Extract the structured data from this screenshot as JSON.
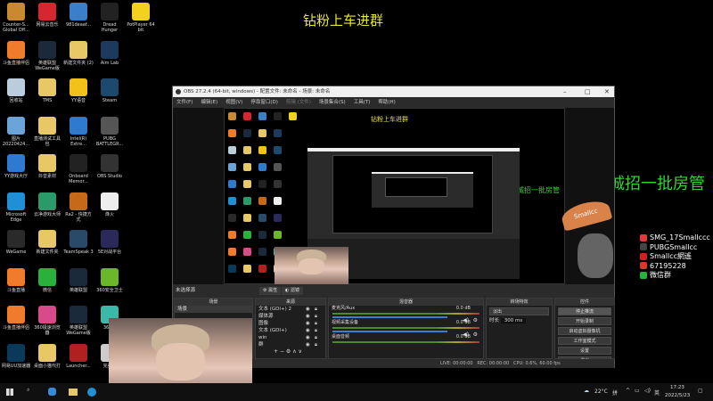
{
  "desktop_icons": [
    {
      "label": "Counter-S... Global Off...",
      "color": "#c8892f"
    },
    {
      "label": "网易云音乐",
      "color": "#d8262e"
    },
    {
      "label": "981deaaf...",
      "color": "#3a7fc9"
    },
    {
      "label": "Dread Hunger",
      "color": "#222"
    },
    {
      "label": "PotPlayer 64 bit",
      "color": "#f2d21b"
    },
    {
      "label": "斗鱼直播伴侣",
      "color": "#f07b2a"
    },
    {
      "label": "英雄联盟 WeGame版",
      "color": "#1a2a3a"
    },
    {
      "label": "新建文件夹 (2)",
      "color": "#e8c766"
    },
    {
      "label": "Aim Lab",
      "color": "#1c3b5c"
    },
    null,
    {
      "label": "回收站",
      "color": "#bcd"
    },
    {
      "label": "TMS",
      "color": "#e8c766"
    },
    {
      "label": "YY语音",
      "color": "#f2c21b"
    },
    {
      "label": "Steam",
      "color": "#1b4a6e"
    },
    null,
    {
      "label": "图片 20220424...",
      "color": "#6aa4d8"
    },
    {
      "label": "直播测试工具包",
      "color": "#e8c766"
    },
    {
      "label": "Intel(R) Extre...",
      "color": "#2e7ad0"
    },
    {
      "label": "PUBG BATTLEGR...",
      "color": "#555"
    },
    null,
    {
      "label": "YY游戏大厅",
      "color": "#2e7ad0"
    },
    {
      "label": "抖音素材",
      "color": "#e8c766"
    },
    {
      "label": "Onboard Memor...",
      "color": "#222"
    },
    {
      "label": "OBS Studio",
      "color": "#333"
    },
    null,
    {
      "label": "Microsoft Edge",
      "color": "#1f8fd6"
    },
    {
      "label": "云净游戏大师",
      "color": "#2a9a6a"
    },
    {
      "label": "Ra2 - 快捷方式",
      "color": "#c66a1a"
    },
    {
      "label": "烽火",
      "color": "#eee"
    },
    null,
    {
      "label": "WeGame",
      "color": "#2a2a2a"
    },
    {
      "label": "新建文件夹",
      "color": "#e8c766"
    },
    {
      "label": "TeamSpeak 3",
      "color": "#2a4a6a"
    },
    {
      "label": "5E对战平台",
      "color": "#2a2a5a"
    },
    null,
    {
      "label": "斗鱼直播",
      "color": "#f07b2a"
    },
    {
      "label": "微信",
      "color": "#2ab13c"
    },
    {
      "label": "英雄联盟",
      "color": "#1a2a3a"
    },
    {
      "label": "360安全卫士",
      "color": "#6ab82a"
    },
    null,
    {
      "label": "斗鱼直播伴侣",
      "color": "#f07b2a"
    },
    {
      "label": "360极速浏览器",
      "color": "#d84a8a"
    },
    {
      "label": "英雄联盟 WeGame版",
      "color": "#1a2a3a"
    },
    {
      "label": "360...",
      "color": "#3ab8a8"
    },
    null,
    {
      "label": "网易UU加速器",
      "color": "#0a3a5a"
    },
    {
      "label": "桌面小猫代打",
      "color": "#e8c766"
    },
    {
      "label": "Launcher...",
      "color": "#b02020"
    },
    {
      "label": "完美...",
      "color": "#ccc"
    },
    null
  ],
  "overlay": {
    "title": "钻粉上车进群",
    "recruit": "诚招一批房管",
    "parachute": "Smallcc",
    "social": [
      {
        "text": "SMG_17Smallccc",
        "color": "#e03a3a"
      },
      {
        "text": "PUBGSmallcc",
        "color": "#222"
      },
      {
        "text": "Smallcc網遙",
        "color": "#d02020"
      },
      {
        "text": "67195228",
        "color": "#d83a2a"
      },
      {
        "text": "微信群",
        "color": "#2ab13c"
      }
    ]
  },
  "obs": {
    "title": "OBS 27.2.4 (64-bit, windows) - 配置文件: 未命名 - 场景: 未命名",
    "menu": [
      "文件(F)",
      "编辑(E)",
      "视图(V)",
      "停靠窗口(D)",
      "剪辑 (文件)",
      "场景集合(S)",
      "工具(T)",
      "帮助(H)"
    ],
    "no_source": "未选择源",
    "properties": "属性",
    "filters": "滤镜",
    "docks": {
      "scenes": "场景",
      "sources": "来源",
      "mixer": "混音器",
      "transitions": "转场特效",
      "controls": "控件"
    },
    "scene_items": [
      "场景"
    ],
    "sources": [
      "文本 (GDI+) 2",
      "媒体源",
      "图像",
      "文本 (GDI+)",
      "win",
      "群"
    ],
    "mixer": [
      {
        "name": "麦克风/Aux",
        "db": "0.0 dB"
      },
      {
        "name": "视频采集设备",
        "db": "0.0 dB"
      },
      {
        "name": "桌面音频",
        "db": "0.0 dB"
      }
    ],
    "transition": {
      "type": "淡出",
      "duration_label": "时长",
      "duration": "300 ms"
    },
    "controls": [
      "停止推流",
      "开始录制",
      "启动虚拟摄像机",
      "工作室模式",
      "设置",
      "退出"
    ],
    "status": {
      "live": "LIVE: 00:00:00",
      "rec": "REC: 00:00:00",
      "cpu": "CPU: 0.6%, 60.00 fps"
    }
  },
  "taskbar": {
    "weather": "22°C",
    "ime": "拼",
    "time": "17:23",
    "date": "2022/5/23",
    "lang": "英"
  }
}
